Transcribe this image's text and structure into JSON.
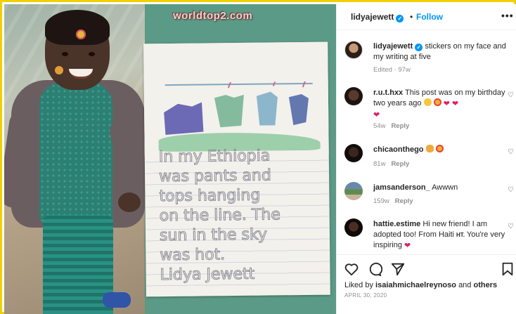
{
  "watermark": "worldtop2.com",
  "post": {
    "username": "lidyajewett",
    "follow_label": "Follow",
    "dot": "•",
    "more_label": "•••",
    "caption": "stickers on my face and my writing at five",
    "caption_meta": "Edited · 97w"
  },
  "comments": [
    {
      "username": "r.u.t.hxx",
      "text": "This post was on my birthday two years ago",
      "age": "54w",
      "reply_label": "Reply",
      "emojis": [
        "laugh-emoji",
        "heart-eyes-emoji",
        "red-heart",
        "red-heart",
        "red-heart"
      ]
    },
    {
      "username": "chicaonthego",
      "text": "",
      "age": "81w",
      "reply_label": "Reply",
      "emojis": [
        "cat-emoji",
        "smiling-hearts-emoji"
      ]
    },
    {
      "username": "jamsanderson_",
      "text": "Awwwn",
      "age": "159w",
      "reply_label": "Reply"
    },
    {
      "username": "hattie.estime",
      "text_1": "Hi new friend! I am adopted too! From Haiti",
      "badge": "HT.",
      "text_2": "You're very inspiring",
      "emojis": [
        "heart-emoji"
      ]
    }
  ],
  "footer": {
    "likes_prefix": "Liked by",
    "likes_user": "isaiahmichaelreynoso",
    "likes_and": "and",
    "likes_others": "others",
    "date": "APRIL 30, 2020"
  },
  "drawing": {
    "line_1": "In my Ethiopia",
    "line_2": "was pants and",
    "line_3": "tops hanging",
    "line_4": "on the line. The",
    "line_5": "sun in the sky",
    "line_6": "was hot.",
    "line_7": "Lidya Jewett"
  },
  "colors": {
    "follow_blue": "#0095f6",
    "frame_yellow": "#f1d000",
    "heart_red": "#e0245e"
  }
}
